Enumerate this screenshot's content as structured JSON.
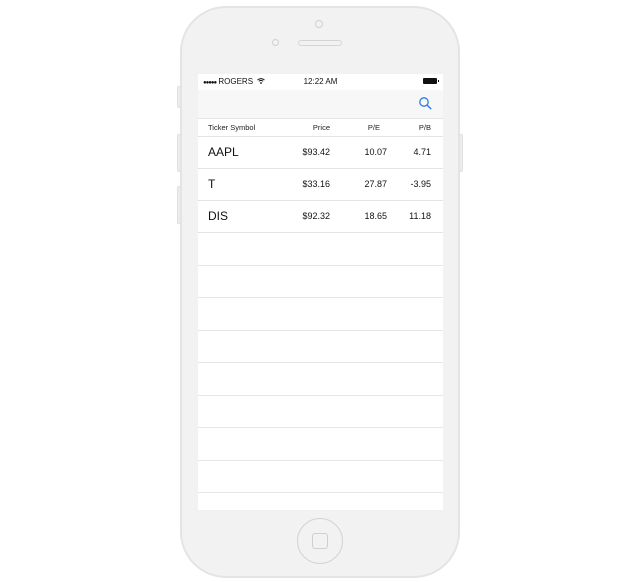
{
  "status_bar": {
    "signal_dots": "●●●●●",
    "carrier": "ROGERS",
    "wifi_icon": "wifi-icon",
    "time": "12:22 AM",
    "battery_icon": "battery-icon"
  },
  "nav_bar": {
    "search_icon": "search-icon",
    "accent_color": "#2a7de1"
  },
  "table": {
    "headers": {
      "ticker": "Ticker Symbol",
      "price": "Price",
      "pe": "P/E",
      "pb": "P/B"
    },
    "rows": [
      {
        "ticker": "AAPL",
        "price": "$93.42",
        "pe": "10.07",
        "pb": "4.71"
      },
      {
        "ticker": "T",
        "price": "$33.16",
        "pe": "27.87",
        "pb": "-3.95"
      },
      {
        "ticker": "DIS",
        "price": "$92.32",
        "pe": "18.65",
        "pb": "11.18"
      }
    ]
  }
}
